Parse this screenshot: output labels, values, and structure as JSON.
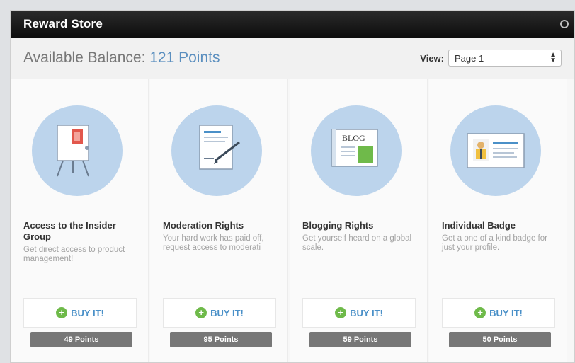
{
  "window": {
    "title": "Reward Store"
  },
  "balance": {
    "label": "Available Balance:",
    "value": "121 Points"
  },
  "view": {
    "label": "View:",
    "selected": "Page 1"
  },
  "colors": {
    "accent": "#5b8fbf",
    "icon_circle": "#bcd4ec",
    "buy_plus": "#6fba4a",
    "price_bg": "#777777"
  },
  "items": [
    {
      "name": "Access to the Insider Group",
      "description": "Get direct access to product management!",
      "buy_label": "BUY IT!",
      "price": "49 Points",
      "icon": "presentation-easel-icon"
    },
    {
      "name": "Moderation Rights",
      "description": "Your hard work has paid off, request access to moderati",
      "buy_label": "BUY IT!",
      "price": "95 Points",
      "icon": "document-pen-icon"
    },
    {
      "name": "Blogging Rights",
      "description": "Get yourself heard on a global scale.",
      "buy_label": "BUY IT!",
      "price": "59 Points",
      "icon": "blog-newspaper-icon",
      "icon_text": "BLOG"
    },
    {
      "name": "Individual Badge",
      "description": "Get a one of a kind badge for just your profile.",
      "buy_label": "BUY IT!",
      "price": "50 Points",
      "icon": "badge-card-icon"
    }
  ]
}
